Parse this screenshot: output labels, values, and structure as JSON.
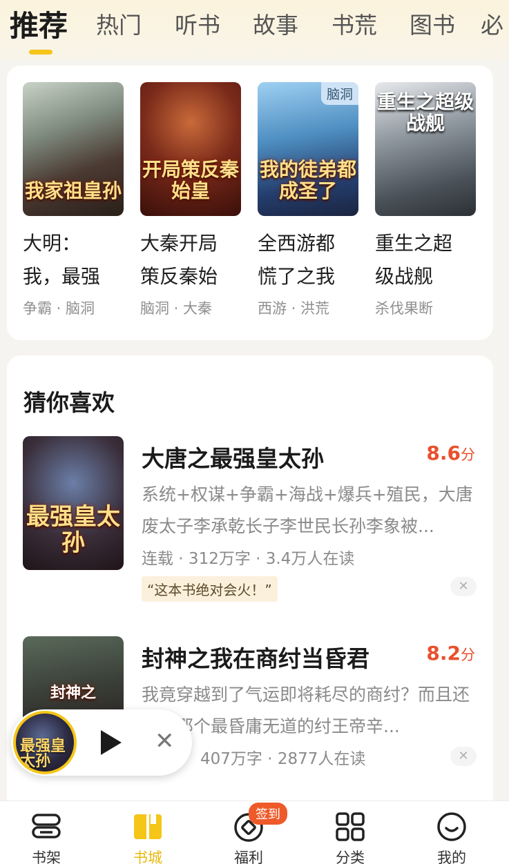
{
  "colors": {
    "accent": "#f5c518",
    "score": "#e8502c",
    "badge": "#ee5a2a",
    "background": "#f6f4f0"
  },
  "top_tabs": [
    {
      "label": "推荐",
      "active": true
    },
    {
      "label": "热门"
    },
    {
      "label": "听书"
    },
    {
      "label": "故事"
    },
    {
      "label": "书荒"
    },
    {
      "label": "图书"
    },
    {
      "label": "必"
    }
  ],
  "recommend": [
    {
      "cover_text": "我家祖皇孙",
      "name": "大明：\n我，最强",
      "meta": "争霸 · 脑洞"
    },
    {
      "cover_text": "开局策反秦始皇",
      "name": "大秦开局\n策反秦始",
      "meta": "脑洞 · 大秦"
    },
    {
      "cover_text": "我的徒弟都成圣了",
      "cover_tag": "脑洞",
      "name": "全西游都\n慌了之我",
      "meta": "西游 · 洪荒"
    },
    {
      "cover_text": "重生之超级战舰",
      "name": "重生之超\n级战舰",
      "meta": "杀伐果断"
    }
  ],
  "guess": {
    "title": "猜你喜欢",
    "items": [
      {
        "cover_text": "最强皇太孙",
        "title": "大唐之最强皇太孙",
        "score": "8.6",
        "score_unit": "分",
        "desc": "系统+权谋+争霸+海战+爆兵+殖民，大唐废太子李承乾长子李世民长孙李象被...",
        "stats": "连载 · 312万字 · 3.4万人在读",
        "quote": "“这本书绝对会火！”"
      },
      {
        "cover_text": "封神之",
        "title": "封神之我在商纣当昏君",
        "score": "8.2",
        "score_unit": "分",
        "desc": "我竟穿越到了气运即将耗尽的商纣？而且还就是那个最昏庸无道的纣王帝辛...",
        "stats": "407万字 · 2877人在读"
      }
    ]
  },
  "player": {
    "disc_text": "最强皇太孙"
  },
  "bottom_nav": [
    {
      "label": "书架",
      "icon": "bookshelf-icon"
    },
    {
      "label": "书城",
      "icon": "book-open-icon",
      "active": true
    },
    {
      "label": "福利",
      "icon": "coin-icon"
    },
    {
      "label": "分类",
      "icon": "grid-icon"
    },
    {
      "label": "我的",
      "icon": "smile-icon"
    }
  ],
  "badge_label": "签到"
}
